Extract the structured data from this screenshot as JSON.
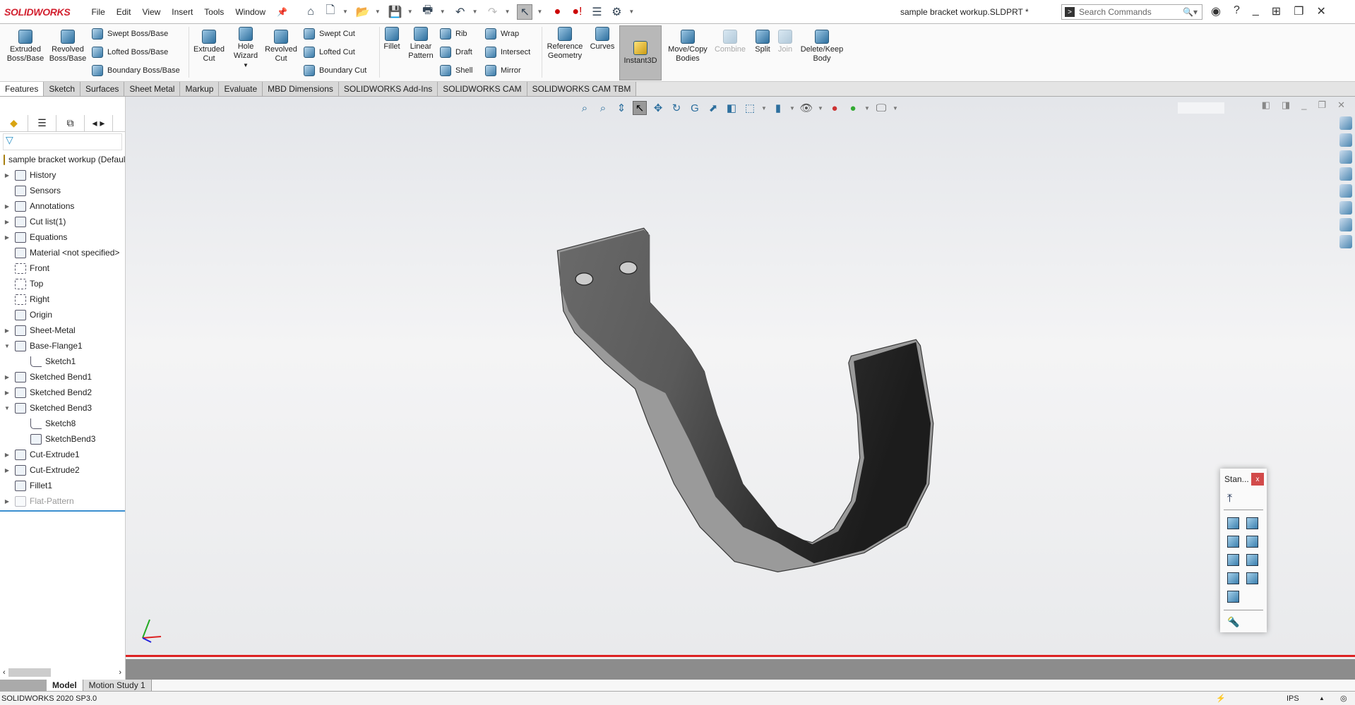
{
  "app": {
    "logo": "SOLIDWORKS",
    "title": "sample bracket workup.SLDPRT *",
    "accent": "#d2202f"
  },
  "menu": [
    "File",
    "Edit",
    "View",
    "Insert",
    "Tools",
    "Window"
  ],
  "search": {
    "placeholder": "Search Commands"
  },
  "ribbon": {
    "large": [
      {
        "label": "Extruded Boss/Base"
      },
      {
        "label": "Revolved Boss/Base"
      },
      {
        "label": "Extruded Cut"
      },
      {
        "label": "Hole Wizard"
      },
      {
        "label": "Revolved Cut"
      },
      {
        "label": "Fillet"
      },
      {
        "label": "Linear Pattern"
      },
      {
        "label": "Reference Geometry"
      },
      {
        "label": "Curves"
      },
      {
        "label": "Instant3D"
      },
      {
        "label": "Move/Copy Bodies"
      },
      {
        "label": "Combine"
      },
      {
        "label": "Split"
      },
      {
        "label": "Join"
      },
      {
        "label": "Delete/Keep Body"
      }
    ],
    "small": [
      {
        "label": "Swept Boss/Base"
      },
      {
        "label": "Lofted Boss/Base"
      },
      {
        "label": "Boundary Boss/Base"
      },
      {
        "label": "Swept Cut"
      },
      {
        "label": "Lofted Cut"
      },
      {
        "label": "Boundary Cut"
      },
      {
        "label": "Rib"
      },
      {
        "label": "Draft"
      },
      {
        "label": "Shell"
      },
      {
        "label": "Wrap"
      },
      {
        "label": "Intersect"
      },
      {
        "label": "Mirror"
      }
    ]
  },
  "tabs": [
    "Features",
    "Sketch",
    "Surfaces",
    "Sheet Metal",
    "Markup",
    "Evaluate",
    "MBD Dimensions",
    "SOLIDWORKS Add-Ins",
    "SOLIDWORKS CAM",
    "SOLIDWORKS CAM TBM"
  ],
  "tree": {
    "root": "sample bracket workup  (Default<<Default>",
    "items": [
      {
        "label": "History",
        "exp": "collapsed",
        "level": 0,
        "icon": "history-folder"
      },
      {
        "label": "Sensors",
        "exp": "",
        "level": 0,
        "icon": "sensors-folder"
      },
      {
        "label": "Annotations",
        "exp": "collapsed",
        "level": 0,
        "icon": "annotations-folder"
      },
      {
        "label": "Cut list(1)",
        "exp": "collapsed",
        "level": 0,
        "icon": "cut-list"
      },
      {
        "label": "Equations",
        "exp": "collapsed",
        "level": 0,
        "icon": "equations-folder"
      },
      {
        "label": "Material <not specified>",
        "exp": "",
        "level": 0,
        "icon": "material"
      },
      {
        "label": "Front",
        "exp": "",
        "level": 0,
        "icon": "plane"
      },
      {
        "label": "Top",
        "exp": "",
        "level": 0,
        "icon": "plane"
      },
      {
        "label": "Right",
        "exp": "",
        "level": 0,
        "icon": "plane"
      },
      {
        "label": "Origin",
        "exp": "",
        "level": 0,
        "icon": "origin"
      },
      {
        "label": "Sheet-Metal",
        "exp": "collapsed",
        "level": 0,
        "icon": "sheet-metal-folder"
      },
      {
        "label": "Base-Flange1",
        "exp": "expanded",
        "level": 0,
        "icon": "base-flange"
      },
      {
        "label": "Sketch1",
        "exp": "",
        "level": 1,
        "icon": "sketch"
      },
      {
        "label": "Sketched Bend1",
        "exp": "collapsed",
        "level": 0,
        "icon": "sketched-bend"
      },
      {
        "label": "Sketched Bend2",
        "exp": "collapsed",
        "level": 0,
        "icon": "sketched-bend"
      },
      {
        "label": "Sketched Bend3",
        "exp": "expanded",
        "level": 0,
        "icon": "sketched-bend"
      },
      {
        "label": "Sketch8",
        "exp": "",
        "level": 1,
        "icon": "sketch"
      },
      {
        "label": "SketchBend3",
        "exp": "",
        "level": 1,
        "icon": "sketch-bend"
      },
      {
        "label": "Cut-Extrude1",
        "exp": "collapsed",
        "level": 0,
        "icon": "cut-extrude"
      },
      {
        "label": "Cut-Extrude2",
        "exp": "collapsed",
        "level": 0,
        "icon": "cut-extrude"
      },
      {
        "label": "Fillet1",
        "exp": "",
        "level": 0,
        "icon": "fillet"
      },
      {
        "label": "Flat-Pattern",
        "exp": "collapsed",
        "level": 0,
        "icon": "flat-pattern",
        "suppressed": true
      }
    ]
  },
  "std_views": {
    "title": "Stan...",
    "close": "x"
  },
  "bottom_tabs": [
    "Model",
    "Motion Study 1"
  ],
  "status": {
    "version": "SOLIDWORKS 2020 SP3.0",
    "units": "IPS"
  }
}
